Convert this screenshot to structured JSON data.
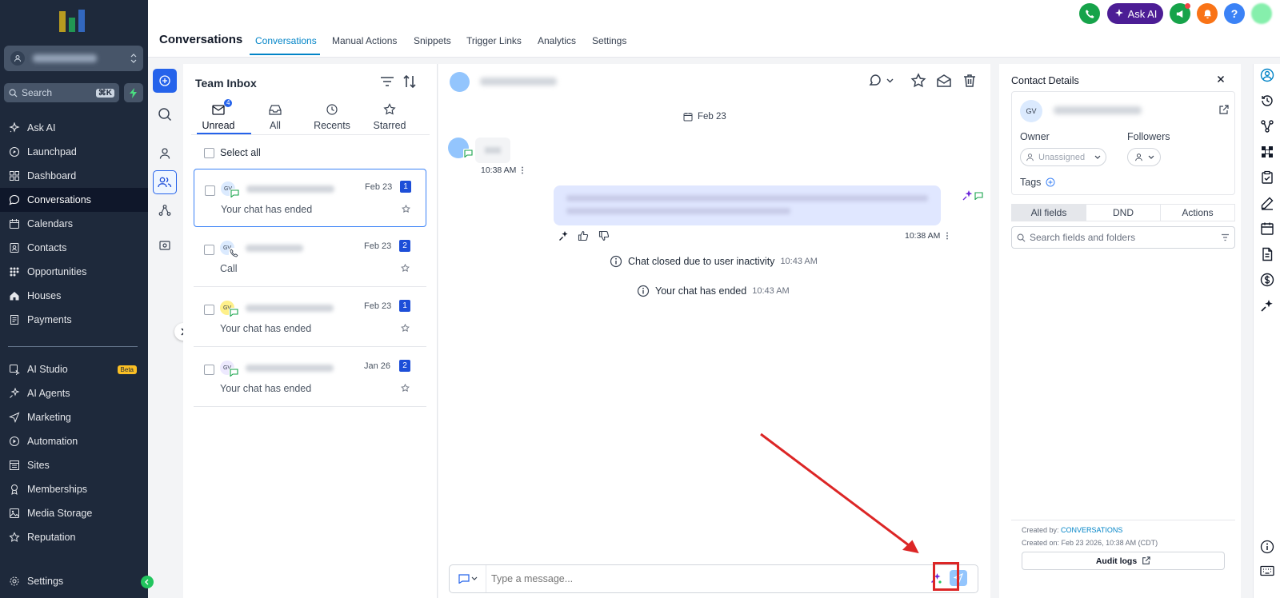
{
  "sidebar": {
    "search_placeholder": "Search",
    "search_shortcut": "⌘K",
    "items": [
      {
        "label": "Ask AI",
        "icon": "sparkle-icon"
      },
      {
        "label": "Launchpad",
        "icon": "rocket-icon"
      },
      {
        "label": "Dashboard",
        "icon": "grid-icon"
      },
      {
        "label": "Conversations",
        "icon": "chat-bubble-icon",
        "active": true
      },
      {
        "label": "Calendars",
        "icon": "calendar-icon"
      },
      {
        "label": "Contacts",
        "icon": "contacts-icon"
      },
      {
        "label": "Opportunities",
        "icon": "funnel-icon"
      },
      {
        "label": "Houses",
        "icon": "house-icon"
      },
      {
        "label": "Payments",
        "icon": "receipt-icon"
      },
      {
        "label": "AI Studio",
        "icon": "ai-studio-icon",
        "badge": "Beta"
      },
      {
        "label": "AI Agents",
        "icon": "ai-agents-icon"
      },
      {
        "label": "Marketing",
        "icon": "send-icon"
      },
      {
        "label": "Automation",
        "icon": "automation-icon"
      },
      {
        "label": "Sites",
        "icon": "sites-icon"
      },
      {
        "label": "Memberships",
        "icon": "award-icon"
      },
      {
        "label": "Media Storage",
        "icon": "image-icon"
      },
      {
        "label": "Reputation",
        "icon": "star-icon"
      },
      {
        "label": "Settings",
        "icon": "gear-icon"
      }
    ]
  },
  "header": {
    "title": "Conversations",
    "tabs": [
      "Conversations",
      "Manual Actions",
      "Snippets",
      "Trigger Links",
      "Analytics",
      "Settings"
    ],
    "active_tab": "Conversations",
    "ask_ai_label": "Ask AI"
  },
  "inbox": {
    "title": "Team Inbox",
    "tabs": [
      {
        "label": "Unread",
        "badge": "4"
      },
      {
        "label": "All"
      },
      {
        "label": "Recents"
      },
      {
        "label": "Starred"
      }
    ],
    "select_all": "Select all",
    "conversations": [
      {
        "initials": "GV",
        "date": "Feb 23",
        "count": "1",
        "preview": "Your chat has ended",
        "channel": "chat"
      },
      {
        "initials": "GV",
        "date": "Feb 23",
        "count": "2",
        "preview": "Call",
        "channel": "phone"
      },
      {
        "initials": "GV",
        "date": "Feb 23",
        "count": "1",
        "preview": "Your chat has ended",
        "channel": "chat"
      },
      {
        "initials": "GV",
        "date": "Jan 26",
        "count": "2",
        "preview": "Your chat has ended",
        "channel": "chat"
      }
    ]
  },
  "chat": {
    "date_divider": "Feb 23",
    "incoming_time": "10:38 AM",
    "outgoing_time": "10:38 AM",
    "system_messages": [
      {
        "text": "Chat closed due to user inactivity",
        "time": "10:43 AM"
      },
      {
        "text": "Your chat has ended",
        "time": "10:43 AM"
      }
    ],
    "composer_placeholder": "Type a message..."
  },
  "contact": {
    "title": "Contact Details",
    "initials": "GV",
    "owner_label": "Owner",
    "owner_value": "Unassigned",
    "followers_label": "Followers",
    "tags_label": "Tags",
    "tabs": [
      "All fields",
      "DND",
      "Actions"
    ],
    "active_tab": "All fields",
    "search_placeholder": "Search fields and folders",
    "created_by_label": "Created by:",
    "created_by_value": "CONVERSATIONS",
    "created_on": "Created on: Feb 23 2026, 10:38 AM (CDT)",
    "audit_logs": "Audit logs"
  },
  "colors": {
    "sidebar_bg": "#1e293b",
    "accent": "#2563eb",
    "active_tab": "#0284c7",
    "ask_ai_bg": "#4c1d95",
    "outgoing_bubble": "#e0e7ff",
    "highlight_box": "#dc2626"
  }
}
